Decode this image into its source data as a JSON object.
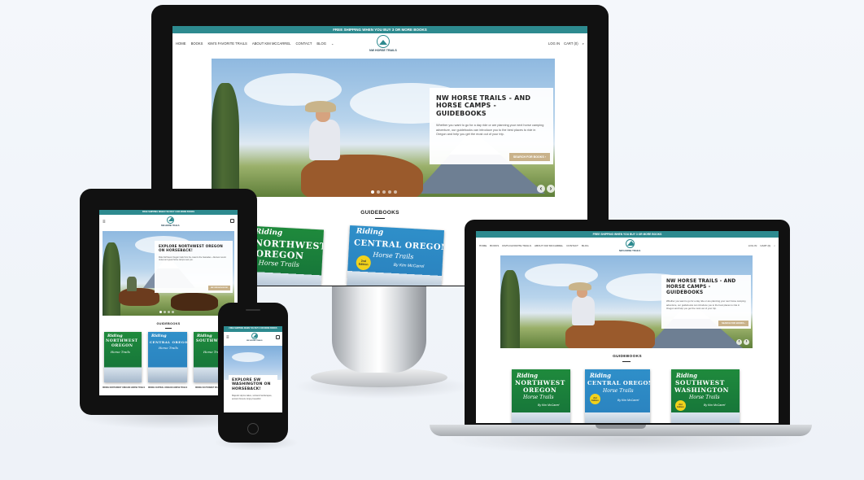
{
  "site": {
    "banner": "FREE SHIPPING WHEN YOU BUY 3 OR MORE BOOKS",
    "logo_text": "NW HORSE TRAILS",
    "nav": [
      "HOME",
      "BOOKS",
      "KIM'S FAVORITE TRAILS",
      "ABOUT KIM MCCARREL",
      "CONTACT",
      "BLOG"
    ],
    "nav_right": [
      "LOG IN",
      "CART (0)"
    ],
    "hero_title": "NW HORSE TRAILS - AND HORSE CAMPS - GUIDEBOOKS",
    "hero_text": "Whether you want to go for a day ride or are planning your next horse camping adventure, our guidebooks can introduce you to the best places to ride in Oregon and help you get the most out of your trip.",
    "hero_button": "SEARCH FOR BOOKS",
    "section_title": "GUIDEBOOKS"
  },
  "tablet": {
    "hero_title": "EXPLORE NORTHWEST OREGON ON HORSEBACK!",
    "hero_text": "Ride Northwest Oregon trails from the coast to the Cascades - discover scenic routes and great horse camps near you.",
    "hero_button": "NW OREGON BOOK",
    "captions": [
      "RIDING NORTHWEST OREGON HORSE TRAILS",
      "RIDING CENTRAL OREGON HORSE TRAILS",
      "RIDING SOUTHWEST WA"
    ]
  },
  "phone": {
    "hero_title": "EXPLORE SW WASHINGTON ON HORSEBACK!",
    "hero_text": "Majestic alpine lakes, volcanic landscapes, ancient forests. Enjoy beautiful"
  },
  "books": [
    {
      "line1": "Riding",
      "line2a": "NORTHWEST",
      "line2b": "OREGON",
      "line3": "Horse Trails",
      "by": "By Kim McCarrel",
      "badge": "",
      "color": "green"
    },
    {
      "line1": "Riding",
      "line2a": "CENTRAL OREGON",
      "line2b": "",
      "line3": "Horse Trails",
      "by": "By Kim McCarrel",
      "badge": "2nd Edition",
      "color": "blue"
    },
    {
      "line1": "Riding",
      "line2a": "SOUTHWEST",
      "line2b": "WASHINGTON",
      "line3": "Horse Trails",
      "by": "By Kim McCarrel",
      "badge": "2nd Edition",
      "color": "green"
    }
  ],
  "icons": [
    "arrow-left-icon",
    "arrow-right-icon",
    "hamburger-menu-icon",
    "cart-icon",
    "search-icon"
  ]
}
